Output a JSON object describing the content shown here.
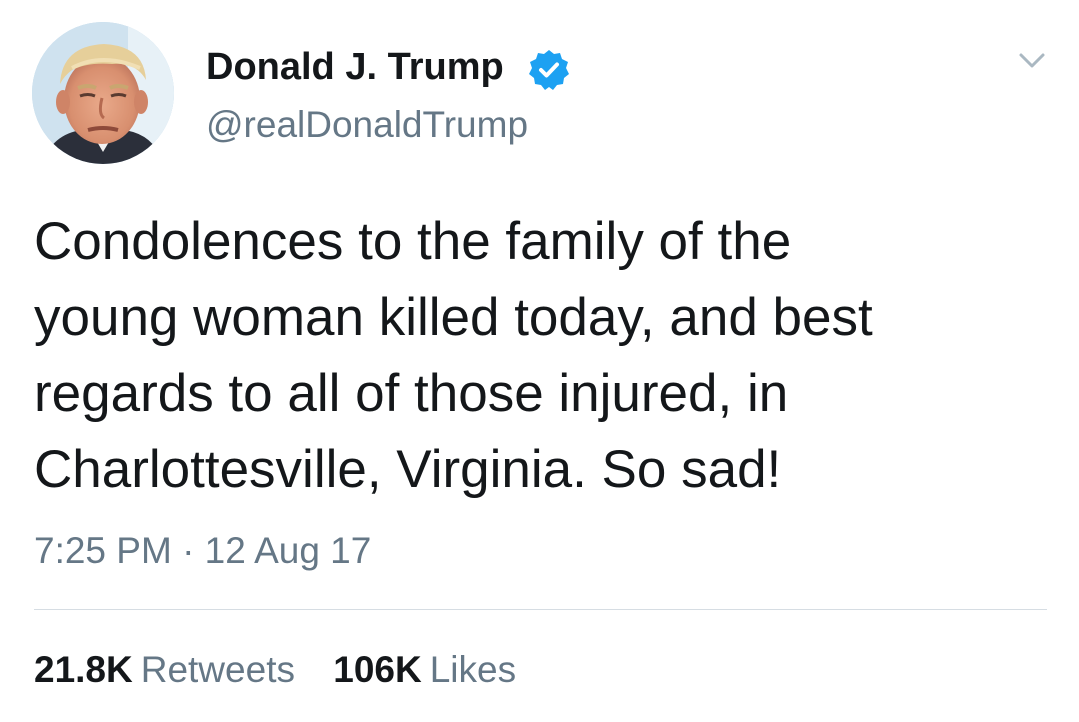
{
  "author": {
    "display_name": "Donald J. Trump",
    "handle": "@realDonaldTrump",
    "verified_icon": "verified-badge-icon",
    "verified_color": "#1da1f2"
  },
  "tweet": {
    "text": "Condolences to the family of the\nyoung woman killed today, and best\nregards to all of those injured, in\nCharlottesville, Virginia. So sad!",
    "timestamp": "7:25 PM · 12 Aug 17"
  },
  "stats": {
    "retweets_count": "21.8K",
    "retweets_label": "Retweets",
    "likes_count": "106K",
    "likes_label": "Likes"
  },
  "menu_icon": "chevron-down-icon"
}
